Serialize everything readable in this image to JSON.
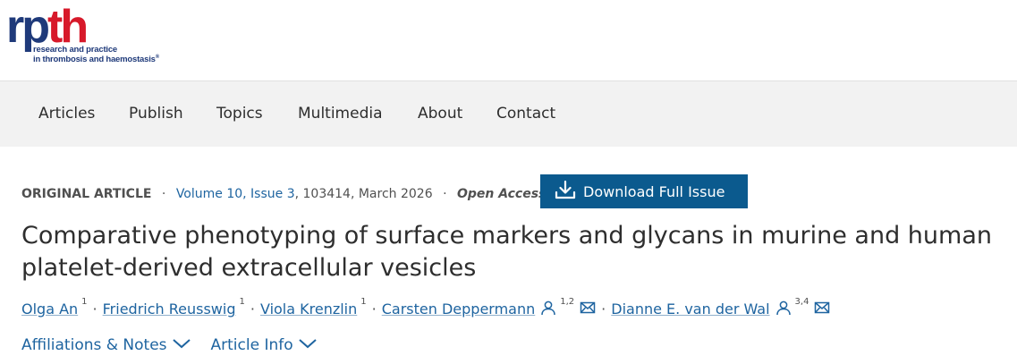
{
  "logo": {
    "word_rp": "rp",
    "word_th": "th",
    "tagline_line1": "research and practice",
    "tagline_line2": "in thrombosis and haemostasis",
    "mark": "®"
  },
  "nav": {
    "items": [
      "Articles",
      "Publish",
      "Topics",
      "Multimedia",
      "About",
      "Contact"
    ]
  },
  "meta": {
    "article_type": "ORIGINAL ARTICLE",
    "volume_issue": "Volume 10, Issue 3",
    "article_number": ", 103414, March 2026",
    "access": "Open Access",
    "separator": "·"
  },
  "download_button": {
    "label": "Download Full Issue",
    "icon": "download-icon"
  },
  "article": {
    "title": "Comparative phenotyping of surface markers and glycans in murine and human platelet-derived extracellular vesicles"
  },
  "authors": [
    {
      "name": "Olga An",
      "sup": "1",
      "person_icon": false,
      "mail_icon": false
    },
    {
      "name": "Friedrich Reusswig",
      "sup": "1",
      "person_icon": false,
      "mail_icon": false
    },
    {
      "name": "Viola Krenzlin",
      "sup": "1",
      "person_icon": false,
      "mail_icon": false
    },
    {
      "name": "Carsten Deppermann",
      "sup": "1,2",
      "person_icon": true,
      "mail_icon": true
    },
    {
      "name": "Dianne E. van der Wal",
      "sup": "3,4",
      "person_icon": true,
      "mail_icon": true
    }
  ],
  "expanders": {
    "affiliations": "Affiliations & Notes",
    "article_info": "Article Info"
  },
  "colors": {
    "link": "#1e64a0",
    "button_bg": "#0b5a8e",
    "nav_bg": "#f2f2f2",
    "logo_blue": "#1f3a7a",
    "logo_red": "#d7192a"
  }
}
